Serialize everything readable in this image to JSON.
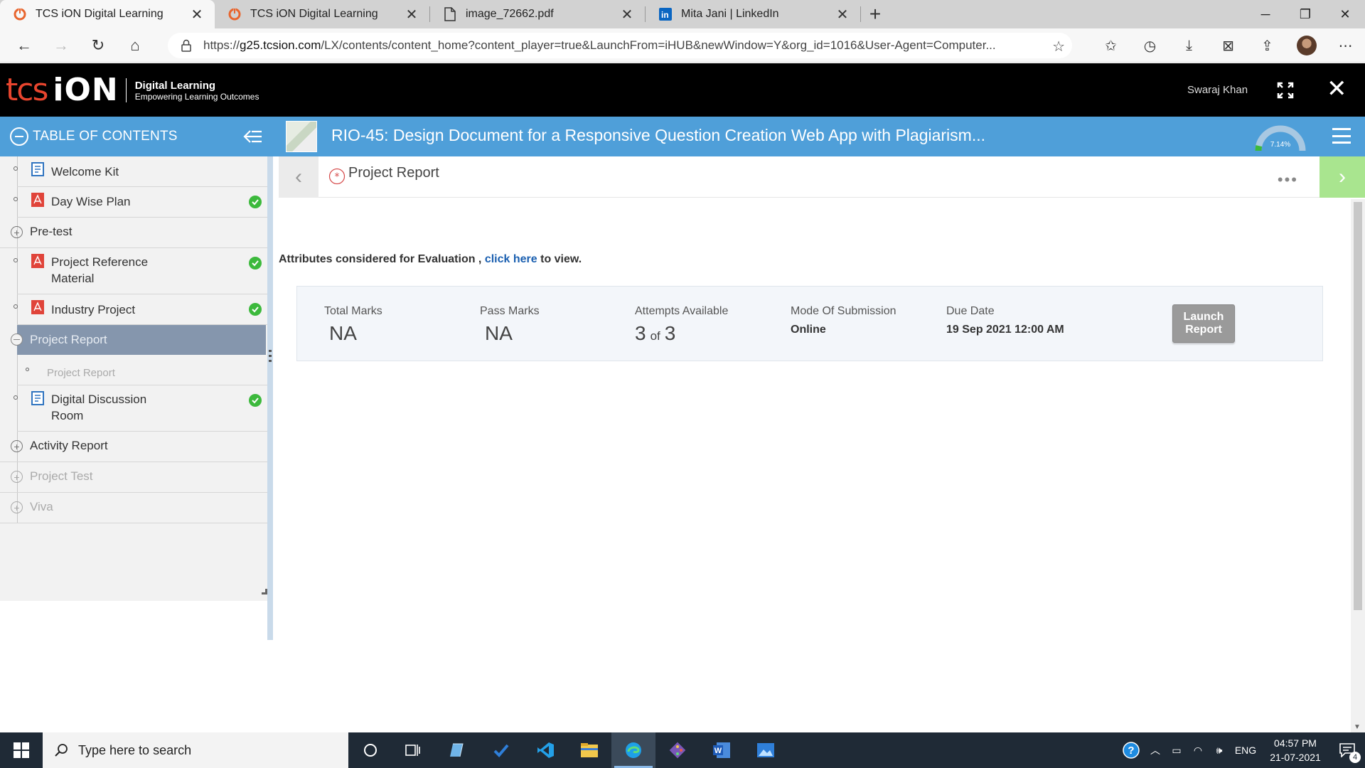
{
  "browser": {
    "tabs": [
      {
        "title": "TCS iON Digital Learning",
        "icon": "tcs-ion-favicon",
        "active": true
      },
      {
        "title": "TCS iON Digital Learning",
        "icon": "tcs-ion-favicon",
        "active": false
      },
      {
        "title": "image_72662.pdf",
        "icon": "file-icon",
        "active": false
      },
      {
        "title": "Mita Jani | LinkedIn",
        "icon": "linkedin-icon",
        "active": false
      }
    ],
    "url_prefix": "https://",
    "url_host": "g25.tcsion.com",
    "url_path": "/LX/contents/content_home?content_player=true&LaunchFrom=iHUB&newWindow=Y&org_id=1016&User-Agent=Computer..."
  },
  "header": {
    "logo_tcs": "tcs",
    "logo_ion": "iON",
    "logo_line1": "Digital Learning",
    "logo_line2": "Empowering Learning Outcomes",
    "user_name": "Swaraj Khan"
  },
  "toc": {
    "title": "TABLE OF CONTENTS",
    "items": [
      {
        "label": "Welcome Kit",
        "icon": "document-icon",
        "done": false
      },
      {
        "label": "Day Wise Plan",
        "icon": "pdf-icon",
        "done": true
      },
      {
        "label": "Pre-test",
        "type": "section"
      },
      {
        "label": "Project Reference Material",
        "icon": "pdf-icon",
        "done": true
      },
      {
        "label": "Industry Project",
        "icon": "pdf-icon",
        "done": true
      },
      {
        "label": "Project Report",
        "type": "section-active"
      },
      {
        "label": "Project Report",
        "type": "sub-item"
      },
      {
        "label": "Digital Discussion Room",
        "icon": "document-icon",
        "done": true
      },
      {
        "label": "Activity Report",
        "type": "section"
      },
      {
        "label": "Project Test",
        "type": "section-disabled"
      },
      {
        "label": "Viva",
        "type": "section-disabled"
      }
    ]
  },
  "content": {
    "course_title": "RIO-45: Design Document for a Responsive Question Creation Web App with Plagiarism...",
    "progress": "7.14%",
    "progress_fraction": 0.0714,
    "section_title": "Project Report",
    "eval_prefix": "Attributes considered for Evaluation ,",
    "eval_link": "click here",
    "eval_suffix": "to view.",
    "total_marks_label": "Total Marks",
    "total_marks": "NA",
    "pass_marks_label": "Pass Marks",
    "pass_marks": "NA",
    "attempts_label": "Attempts Available",
    "attempts_available": "3",
    "attempts_of": "of",
    "attempts_total": "3",
    "mode_label": "Mode Of Submission",
    "mode_value": "Online",
    "due_label": "Due Date",
    "due_value": "19 Sep 2021 12:00 AM",
    "launch_button": "Launch Report"
  },
  "taskbar": {
    "search_placeholder": "Type here to search",
    "language": "ENG",
    "time": "04:57 PM",
    "date": "21-07-2021",
    "notification_count": "4"
  },
  "colors": {
    "accent_blue": "#4f9fd9",
    "tcs_red": "#e8452e",
    "check_green": "#3cb93c",
    "next_green": "#a9e58f",
    "toc_active": "#8596ad"
  }
}
